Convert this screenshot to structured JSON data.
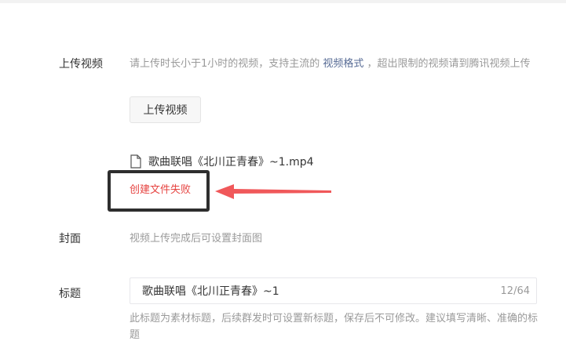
{
  "upload": {
    "label": "上传视频",
    "hint_before": "请上传时长小于1小时的视频，支持主流的 ",
    "hint_link": "视频格式",
    "hint_after": " ，超出限制的视频请到腾讯视频上传",
    "button_label": "上传视频",
    "file_icon": "file-icon",
    "file_name": "歌曲联唱《北川正青春》~1.mp4",
    "error_text": "创建文件失败",
    "error_color": "#e64340"
  },
  "cover": {
    "label": "封面",
    "hint": "视频上传完成后可设置封面图"
  },
  "title": {
    "label": "标题",
    "value": "歌曲联唱《北川正青春》~1",
    "counter": "12/64",
    "hint": "此标题为素材标题，后续群发时可设置新标题，保存后不可修改。建议填写清晰、准确的标题"
  },
  "annotation": {
    "box_color": "#2e2e2e",
    "arrow_color": "#f0585a"
  }
}
